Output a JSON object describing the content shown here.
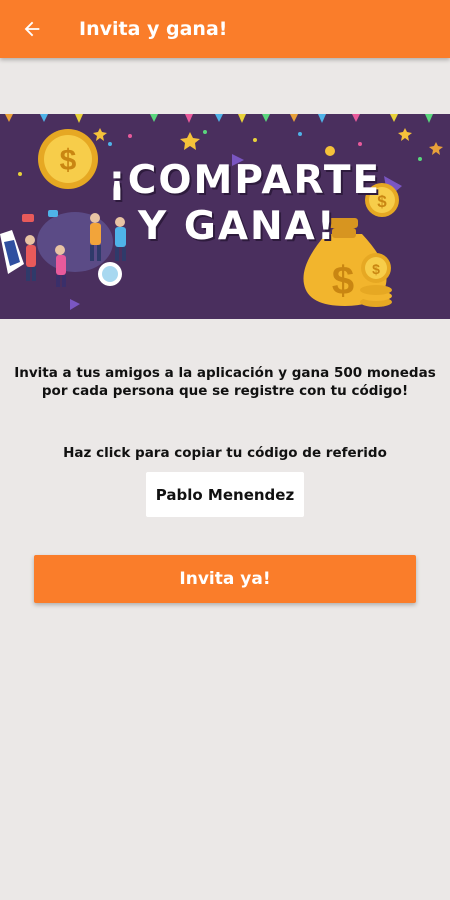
{
  "colors": {
    "primary": "#fa7d2a",
    "background": "#ebe8e7",
    "banner": "#4a2f5e",
    "coin": "#f5c23a"
  },
  "appbar": {
    "back_icon": "arrow-left-icon",
    "title": "Invita y gana!"
  },
  "banner": {
    "headline_line1": "¡COMPARTE",
    "headline_line2": "Y GANA!"
  },
  "content": {
    "description_line1": "Invita a tus amigos a la aplicación y gana 500 monedas",
    "description_line2": "por cada persona que se registre con tu código!",
    "copy_label": "Haz click para copiar tu código de referido",
    "referral_code": "Pablo Menendez",
    "invite_button": "Invita ya!"
  }
}
